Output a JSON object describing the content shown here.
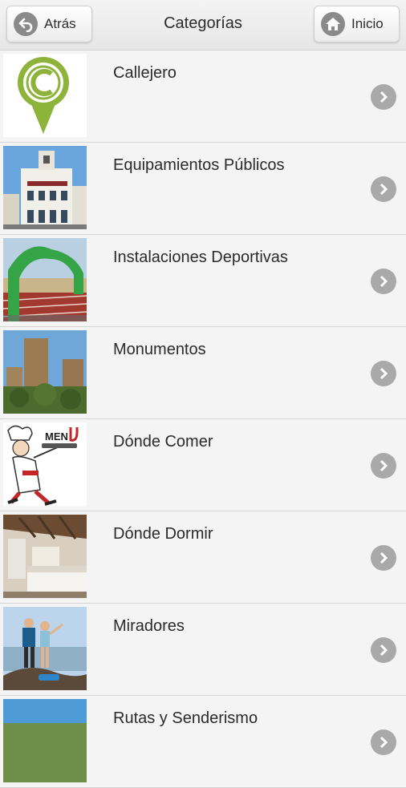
{
  "header": {
    "title": "Categorías",
    "back_label": "Atrás",
    "home_label": "Inicio"
  },
  "categories": [
    {
      "label": "Callejero",
      "icon": "callejero-logo"
    },
    {
      "label": "Equipamientos Públicos",
      "icon": "town-hall-photo"
    },
    {
      "label": "Instalaciones Deportivas",
      "icon": "sports-track-photo"
    },
    {
      "label": "Monumentos",
      "icon": "castle-photo"
    },
    {
      "label": "Dónde Comer",
      "icon": "chef-menu-illustration"
    },
    {
      "label": "Dónde Dormir",
      "icon": "bedroom-photo"
    },
    {
      "label": "Miradores",
      "icon": "hikers-viewpoint-photo"
    },
    {
      "label": "Rutas y Senderismo",
      "icon": "landscape-photo"
    }
  ],
  "colors": {
    "logo_green": "#8db33b",
    "chevron_grey": "#a9a9a9",
    "header_bg": "#eeeeee"
  }
}
